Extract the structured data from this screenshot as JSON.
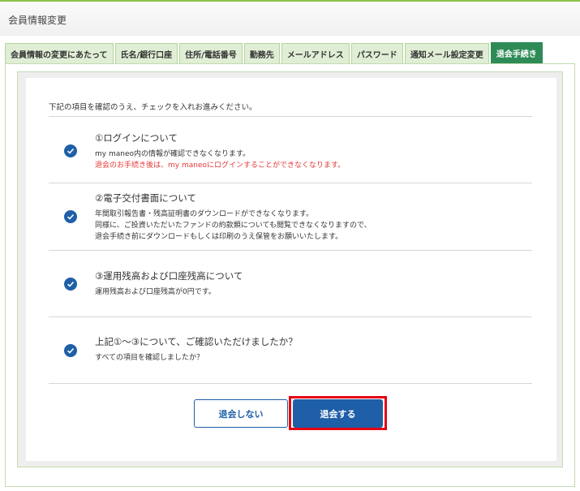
{
  "header": {
    "title": "会員情報変更"
  },
  "tabs": [
    {
      "label": "会員情報の変更にあたって"
    },
    {
      "label": "氏名/銀行口座"
    },
    {
      "label": "住所/電話番号"
    },
    {
      "label": "勤務先"
    },
    {
      "label": "メールアドレス"
    },
    {
      "label": "パスワード"
    },
    {
      "label": "通知メール設定変更"
    },
    {
      "label": "退会手続き"
    }
  ],
  "intro": "下記の項目を確認のうえ、チェックを入れお進みください。",
  "sections": [
    {
      "title": "①ログインについて",
      "lines": [
        "my maneo内の情報が確認できなくなります。",
        "退会のお手続き後は、my maneoにログインすることができなくなります。"
      ]
    },
    {
      "title": "②電子交付書面について",
      "lines": [
        "年間取引報告書・残高証明書のダウンロードができなくなります。",
        "同様に、ご投資いただいたファンドの約款類についても閲覧できなくなりますので、",
        "退会手続き前にダウンロードもしくは印刷のうえ保管をお願いいたします。"
      ]
    },
    {
      "title": "③運用残高および口座残高について",
      "lines": [
        "運用残高および口座残高が0円です。"
      ]
    },
    {
      "title": "上記①～③について、ご確認いただけましたか？",
      "lines": [
        "すべての項目を確認しましたか？"
      ]
    }
  ],
  "buttons": {
    "cancel": "退会しない",
    "withdraw": "退会する"
  },
  "colors": {
    "accent_green": "#2e8b57",
    "primary_blue": "#1f5fa8",
    "warning_red": "#e53935",
    "highlight_red": "#e50012"
  },
  "icons": {
    "check": "check-circle-icon"
  }
}
